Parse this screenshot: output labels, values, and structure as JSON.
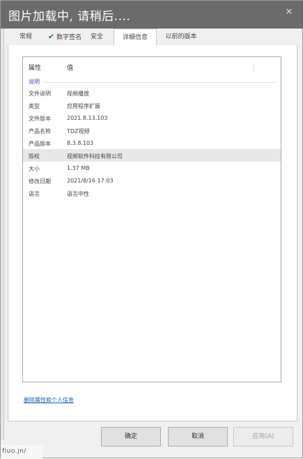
{
  "overlay": {
    "loading_text": "图片加载中, 请稍后....",
    "close_glyph": "✕"
  },
  "tabs": [
    {
      "label": "常规"
    },
    {
      "label": "数字签名",
      "check": "✔"
    },
    {
      "label": "安全"
    },
    {
      "label": "详细信息"
    },
    {
      "label": "以前的版本"
    }
  ],
  "details": {
    "header_property": "属性",
    "header_value": "值",
    "group": "说明",
    "rows": [
      {
        "key": "文件说明",
        "value": "视频播放"
      },
      {
        "key": "类型",
        "value": "应用程序扩展"
      },
      {
        "key": "文件版本",
        "value": "2021.8.13.103"
      },
      {
        "key": "产品名称",
        "value": "TDZ视频"
      },
      {
        "key": "产品版本",
        "value": "8.3.8.103"
      },
      {
        "key": "版权",
        "value": "视频软件科技有限公司"
      },
      {
        "key": "大小",
        "value": "1.37 MB"
      },
      {
        "key": "修改日期",
        "value": "2021/8/16 17:03"
      },
      {
        "key": "语言",
        "value": "语言中性"
      }
    ]
  },
  "privacy_link": "删除属性和个人信息",
  "buttons": {
    "ok": "确定",
    "cancel": "取消",
    "apply": "应用(A)"
  },
  "bottom_edge_text": "fiuo.jn/"
}
